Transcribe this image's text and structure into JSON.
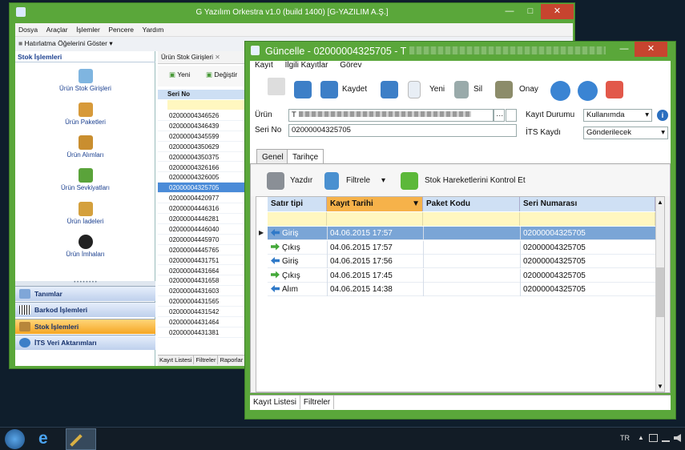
{
  "main": {
    "title": "G Yazılım Orkestra v1.0 (build 1400) [G-YAZILIM A.Ş.]",
    "menu": [
      "Dosya",
      "Araçlar",
      "İşlemler",
      "Pencere",
      "Yardım"
    ],
    "reminder": "Hatırlatma Öğelerini Göster",
    "stok": {
      "header": "Stok İşlemleri",
      "items": [
        "Ürün Stok Girişleri",
        "Ürün Paketleri",
        "Ürün Alımları",
        "Ürün Sevkiyatları",
        "Ürün İadeleri",
        "Ürün İmhaları"
      ]
    },
    "nav": [
      "Tanımlar",
      "Barkod İşlemleri",
      "Stok İşlemleri",
      "İTS Veri Aktarımları"
    ],
    "list": {
      "tab": "Ürün Stok Girişleri",
      "new": "Yeni",
      "change": "Değiştir",
      "header": "Seri No",
      "rows": [
        "02000004346526",
        "02000004346439",
        "02000004345599",
        "02000004350629",
        "02000004350375",
        "02000004326166",
        "02000004326005",
        "02000004325705",
        "02000004420977",
        "02000004446316",
        "02000004446281",
        "02000004446040",
        "02000004445970",
        "02000004445765",
        "02000004431751",
        "02000004431664",
        "02000004431658",
        "02000004431603",
        "02000004431565",
        "02000004431542",
        "02000004431464",
        "02000004431381"
      ],
      "bottom_tabs": [
        "Kayıt Listesi",
        "Filtreler",
        "Raporlar"
      ]
    }
  },
  "dialog": {
    "title": "Güncelle - 02000004325705 - T",
    "menu": [
      "Kayıt",
      "İlgili Kayıtlar",
      "Görev"
    ],
    "toolbar": {
      "save": "Kaydet",
      "new": "Yeni",
      "delete": "Sil",
      "approve": "Onay"
    },
    "form": {
      "urun_label": "Ürün",
      "urun_value": "T",
      "seri_label": "Seri No",
      "seri_value": "02000004325705",
      "status_label": "Kayıt Durumu",
      "status_value": "Kullanımda",
      "its_label": "İTS Kaydı",
      "its_value": "Gönderilecek"
    },
    "tabs": [
      "Genel",
      "Tarihçe"
    ],
    "hist": {
      "print": "Yazdır",
      "filter": "Filtrele",
      "check": "Stok Hareketlerini Kontrol Et",
      "columns": [
        "Satır tipi",
        "Kayıt Tarihi",
        "Paket Kodu",
        "Seri Numarası"
      ],
      "rows": [
        {
          "type": "Giriş",
          "date": "04.06.2015 17:57",
          "pkg": "",
          "serial": "02000004325705",
          "dir": "in"
        },
        {
          "type": "Çıkış",
          "date": "04.06.2015 17:57",
          "pkg": "",
          "serial": "02000004325705",
          "dir": "out"
        },
        {
          "type": "Giriş",
          "date": "04.06.2015 17:56",
          "pkg": "",
          "serial": "02000004325705",
          "dir": "in"
        },
        {
          "type": "Çıkış",
          "date": "04.06.2015 17:45",
          "pkg": "",
          "serial": "02000004325705",
          "dir": "out"
        },
        {
          "type": "Alım",
          "date": "04.06.2015 14:38",
          "pkg": "",
          "serial": "02000004325705",
          "dir": "in"
        }
      ]
    },
    "bottom_tabs": [
      "Kayıt Listesi",
      "Filtreler"
    ]
  },
  "taskbar": {
    "lang": "TR"
  },
  "colors": {
    "window_frame": "#5aa73a",
    "selected_row": "#4a8bd8",
    "sort_header": "#f6b24a",
    "filter_row": "#fff7c0",
    "close": "#c7442f"
  }
}
